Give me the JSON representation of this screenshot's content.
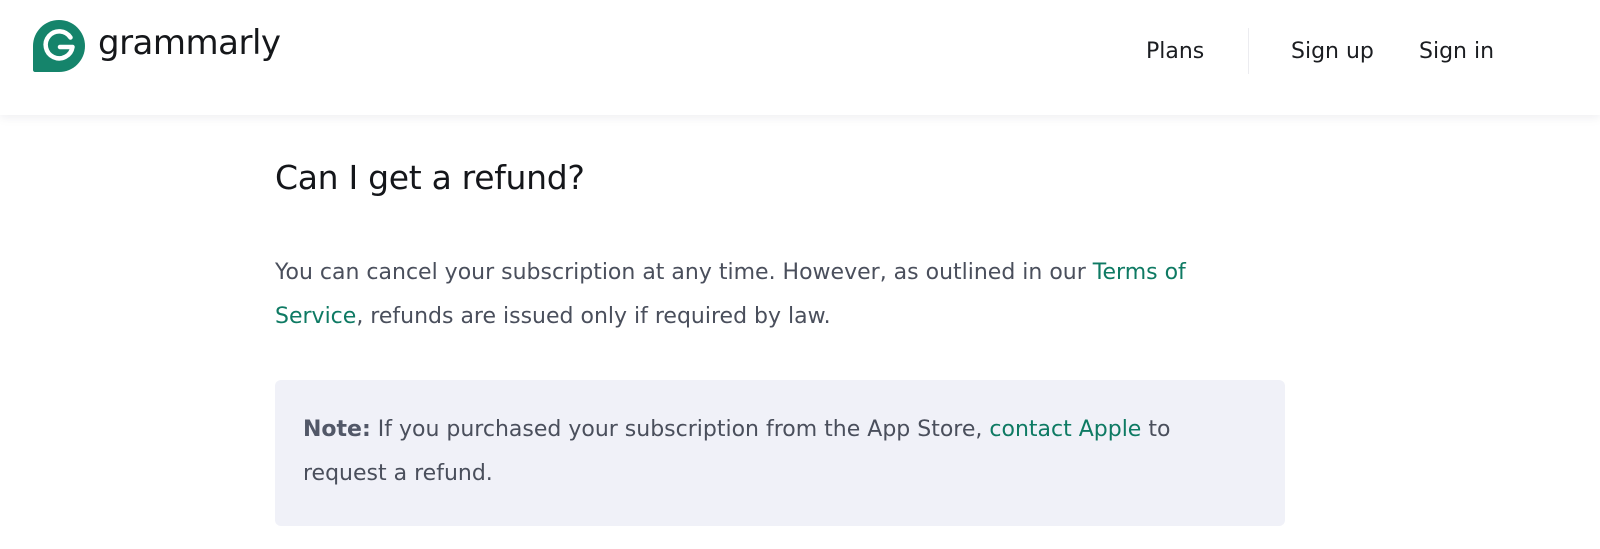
{
  "header": {
    "logo": {
      "text": "grammarly",
      "icon": "grammarly-g-logo-icon",
      "color": "#15846b"
    },
    "nav": {
      "plans": "Plans",
      "sign_up": "Sign up",
      "sign_in": "Sign in"
    }
  },
  "article": {
    "title": "Can I get a refund?",
    "paragraph": {
      "before_link": "You can cancel your subscription at any time. However, as outlined in our ",
      "link": "Terms of Service",
      "after_link": ", refunds are issued only if required by law."
    },
    "note": {
      "label": "Note:",
      "before_link": " If you purchased your subscription from the App Store, ",
      "link": "contact Apple",
      "after_link": " to request a refund."
    }
  },
  "colors": {
    "accent": "#0e7a63",
    "note_background": "#f0f1f8",
    "body_text": "#4a4f5c"
  }
}
